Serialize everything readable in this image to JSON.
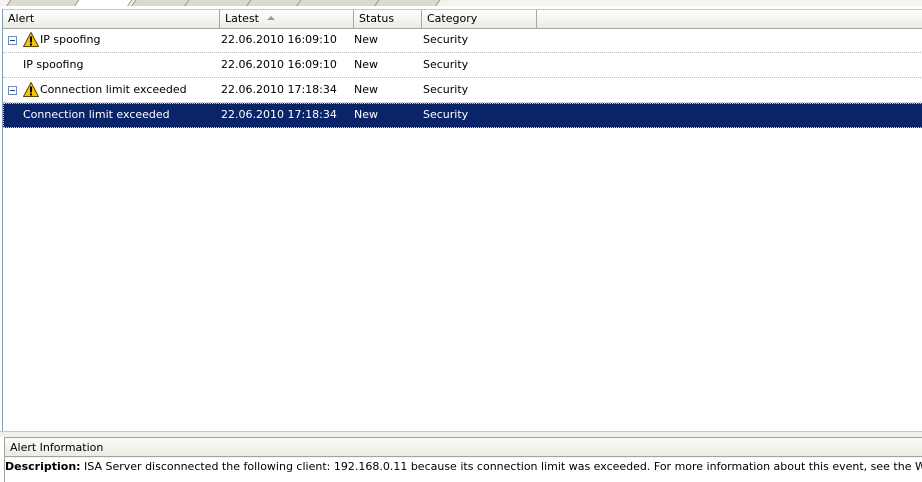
{
  "columns": {
    "alert": "Alert",
    "latest": "Latest",
    "status": "Status",
    "category": "Category"
  },
  "rows": [
    {
      "alert": "IP spoofing",
      "latest": "22.06.2010 16:09:10",
      "status": "New",
      "category": "Security",
      "group": true,
      "icon": "warning-icon"
    },
    {
      "alert": "IP spoofing",
      "latest": "22.06.2010 16:09:10",
      "status": "New",
      "category": "Security",
      "group": false
    },
    {
      "alert": "Connection limit exceeded",
      "latest": "22.06.2010 17:18:34",
      "status": "New",
      "category": "Security",
      "group": true,
      "icon": "warning-icon"
    },
    {
      "alert": "Connection limit exceeded",
      "latest": "22.06.2010 17:18:34",
      "status": "New",
      "category": "Security",
      "group": false,
      "selected": true
    }
  ],
  "info_panel": {
    "title": "Alert Information",
    "description_label": "Description:",
    "description_text": " ISA Server disconnected the following client: 192.168.0.11 because its connection limit was exceeded. For more information about this event, see the Windows event viewer."
  },
  "colors": {
    "selection": "#0a246a",
    "warning": "#f5c400"
  }
}
